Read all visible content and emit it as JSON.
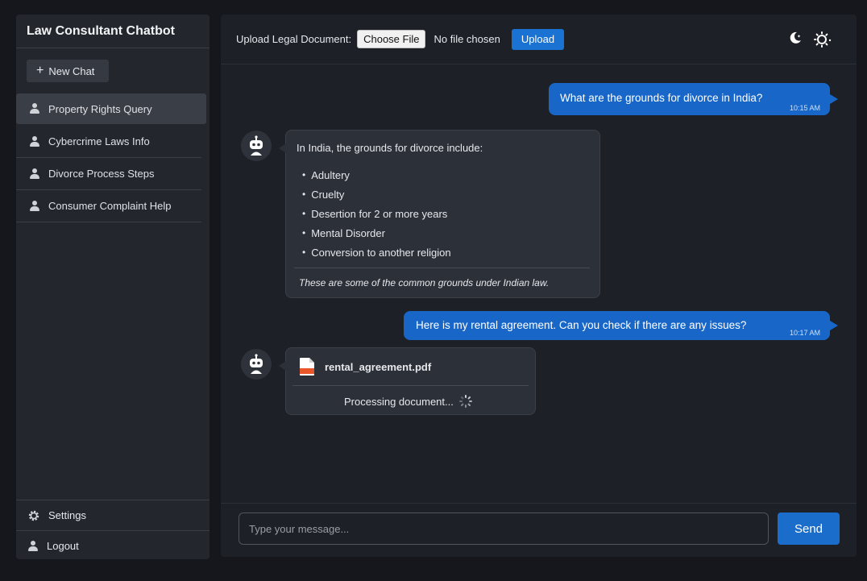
{
  "sidebar": {
    "title": "Law Consultant Chatbot",
    "new_chat_label": "New Chat",
    "items": [
      {
        "label": "Property Rights Query",
        "active": true
      },
      {
        "label": "Cybercrime Laws Info"
      },
      {
        "label": "Divorce Process Steps"
      },
      {
        "label": "Consumer Complaint Help"
      }
    ],
    "settings_label": "Settings",
    "logout_label": "Logout"
  },
  "topbar": {
    "upload_label": "Upload Legal Document:",
    "choose_file_label": "Choose File",
    "no_file_text": "No file chosen",
    "upload_button_label": "Upload"
  },
  "messages": {
    "user1": {
      "text": "What are the grounds for divorce in India?",
      "time": "10:15 AM"
    },
    "bot1": {
      "intro": "In India, the grounds for divorce include:",
      "items": [
        "Adultery",
        "Cruelty",
        "Desertion for 2 or more years",
        "Mental Disorder",
        "Conversion to another religion"
      ],
      "note": "These are some of the common grounds under Indian law."
    },
    "user2": {
      "text": "Here is my rental agreement. Can you check if there are any issues?",
      "time": "10:17 AM"
    },
    "bot2": {
      "file_name": "rental_agreement.pdf",
      "status": "Processing document..."
    }
  },
  "composer": {
    "placeholder": "Type your message...",
    "send_label": "Send"
  },
  "colors": {
    "accent": "#1a73d2",
    "user_bubble": "#1867c8",
    "bot_bubble": "#2c3038",
    "background": "#15171c"
  }
}
